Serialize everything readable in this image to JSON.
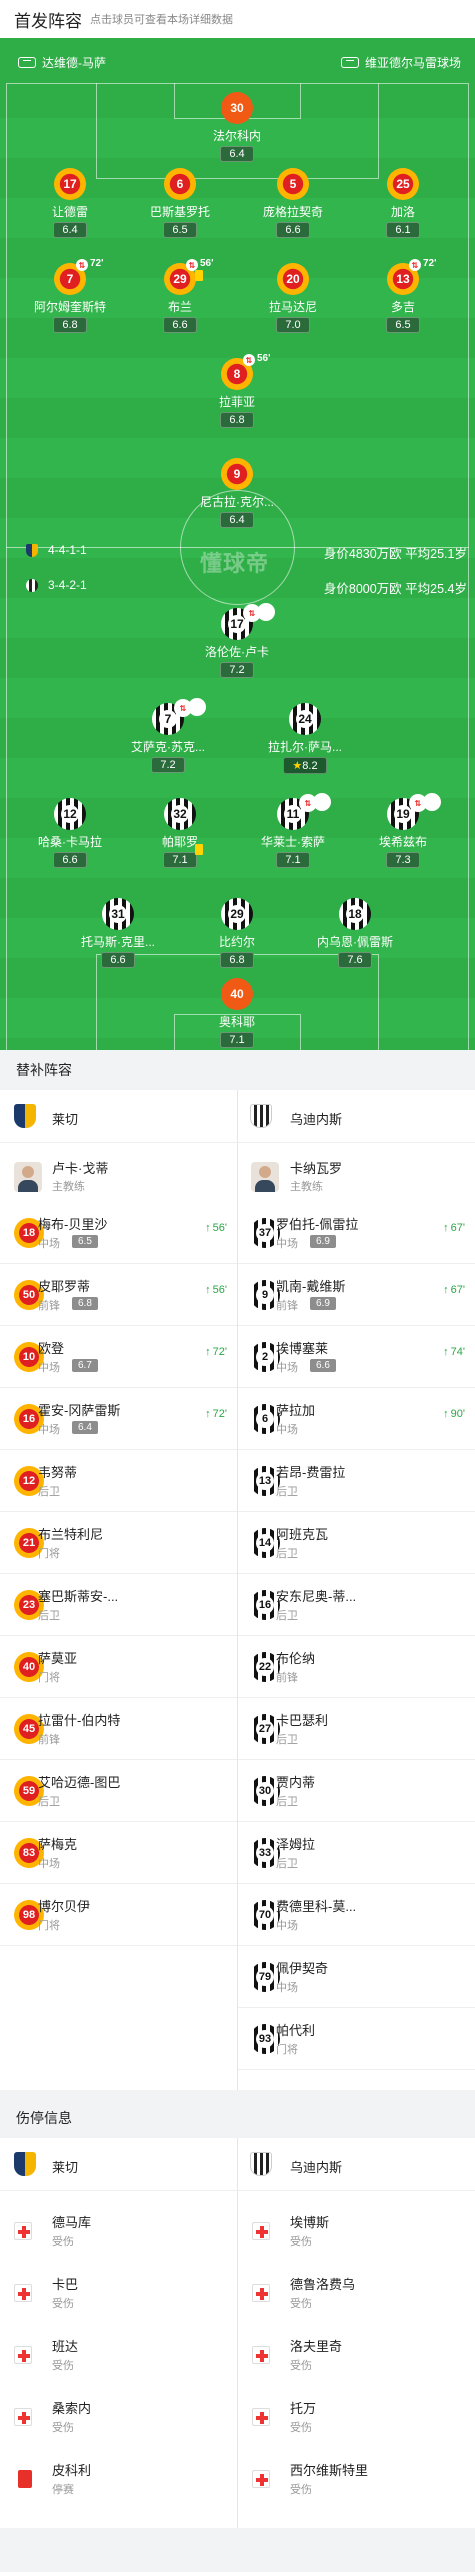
{
  "header": {
    "title": "首发阵容",
    "subtitle": "点击球员可查看本场详细数据"
  },
  "pitch": {
    "home_team_label": "达维德-马萨",
    "away_team_label": "维亚德尔马雷球场",
    "watermark": "懂球帝",
    "away_formation": "4-4-1-1",
    "away_info": "身价4830万欧 平均25.1岁",
    "home_formation": "3-4-2-1",
    "home_info": "身价8000万欧 平均25.4岁"
  },
  "lineup_top": [
    {
      "num": "30",
      "name": "法尔科内",
      "rating": "6.4",
      "kit": "gk"
    },
    {
      "num": "17",
      "name": "让德雷",
      "rating": "6.4",
      "kit": "red"
    },
    {
      "num": "6",
      "name": "巴斯基罗托",
      "rating": "6.5",
      "kit": "red"
    },
    {
      "num": "5",
      "name": "庞格拉契奇",
      "rating": "6.6",
      "kit": "red"
    },
    {
      "num": "25",
      "name": "加洛",
      "rating": "6.1",
      "kit": "red"
    },
    {
      "num": "7",
      "name": "阿尔姆奎斯特",
      "rating": "6.8",
      "kit": "red",
      "event": "72'"
    },
    {
      "num": "29",
      "name": "布兰",
      "rating": "6.6",
      "kit": "red",
      "event": "56'"
    },
    {
      "num": "20",
      "name": "拉马达尼",
      "rating": "7.0",
      "kit": "red"
    },
    {
      "num": "13",
      "name": "多吉",
      "rating": "6.5",
      "kit": "red",
      "event": "72'"
    },
    {
      "num": "8",
      "name": "拉菲亚",
      "rating": "6.8",
      "kit": "red",
      "event": "56'"
    },
    {
      "num": "9",
      "name": "尼古拉·克尔...",
      "rating": "6.4",
      "kit": "red"
    }
  ],
  "lineup_bottom": [
    {
      "num": "17",
      "name": "洛伦佐·卢卡",
      "rating": "7.2",
      "kit": "stripe",
      "event": "67'"
    },
    {
      "num": "7",
      "name": "艾萨克·苏克...",
      "rating": "7.2",
      "kit": "stripe",
      "event": "67'"
    },
    {
      "num": "24",
      "name": "拉扎尔·萨马...",
      "rating": "8.2",
      "kit": "stripe",
      "star": true
    },
    {
      "num": "12",
      "name": "哈桑·卡马拉",
      "rating": "6.6",
      "kit": "stripe"
    },
    {
      "num": "32",
      "name": "帕耶罗",
      "rating": "7.1",
      "kit": "stripe"
    },
    {
      "num": "11",
      "name": "华莱士·索萨",
      "rating": "7.1",
      "kit": "stripe",
      "event": "90'"
    },
    {
      "num": "19",
      "name": "埃希兹布",
      "rating": "7.3",
      "kit": "stripe",
      "event": "74'"
    },
    {
      "num": "31",
      "name": "托马斯·克里...",
      "rating": "6.6",
      "kit": "stripe"
    },
    {
      "num": "29",
      "name": "比约尔",
      "rating": "6.8",
      "kit": "stripe"
    },
    {
      "num": "18",
      "name": "内乌恩·佩雷斯",
      "rating": "7.6",
      "kit": "stripe"
    },
    {
      "num": "40",
      "name": "奥科耶",
      "rating": "7.1",
      "kit": "gk"
    }
  ],
  "subs_section": {
    "title": "替补阵容",
    "left_team": "莱切",
    "right_team": "乌迪内斯",
    "left_coach": {
      "name": "卢卡·戈蒂",
      "role": "主教练"
    },
    "right_coach": {
      "name": "卡纳瓦罗",
      "role": "主教练"
    },
    "left": [
      {
        "num": "18",
        "name": "梅布-贝里沙",
        "pos": "中场",
        "rating": "6.5",
        "time": "56'"
      },
      {
        "num": "50",
        "name": "皮耶罗蒂",
        "pos": "前锋",
        "rating": "6.8",
        "time": "56'"
      },
      {
        "num": "10",
        "name": "欧登",
        "pos": "中场",
        "rating": "6.7",
        "time": "72'"
      },
      {
        "num": "16",
        "name": "霍安-冈萨雷斯",
        "pos": "中场",
        "rating": "6.4",
        "time": "72'"
      },
      {
        "num": "12",
        "name": "韦努蒂",
        "pos": "后卫"
      },
      {
        "num": "21",
        "name": "布兰特利尼",
        "pos": "门将"
      },
      {
        "num": "23",
        "name": "塞巴斯蒂安-...",
        "pos": "后卫"
      },
      {
        "num": "40",
        "name": "萨莫亚",
        "pos": "门将"
      },
      {
        "num": "45",
        "name": "拉雷什-伯内特",
        "pos": "前锋"
      },
      {
        "num": "59",
        "name": "艾哈迈德-图巴",
        "pos": "后卫"
      },
      {
        "num": "83",
        "name": "萨梅克",
        "pos": "中场"
      },
      {
        "num": "98",
        "name": "博尔贝伊",
        "pos": "门将"
      }
    ],
    "right": [
      {
        "num": "37",
        "name": "罗伯托-佩雷拉",
        "pos": "中场",
        "rating": "6.9",
        "time": "67'"
      },
      {
        "num": "9",
        "name": "凯南-戴维斯",
        "pos": "前锋",
        "rating": "6.9",
        "time": "67'"
      },
      {
        "num": "2",
        "name": "埃博塞莱",
        "pos": "中场",
        "rating": "6.6",
        "time": "74'"
      },
      {
        "num": "6",
        "name": "萨拉加",
        "pos": "中场",
        "time": "90'"
      },
      {
        "num": "13",
        "name": "若昂-费雷拉",
        "pos": "后卫"
      },
      {
        "num": "14",
        "name": "阿班克瓦",
        "pos": "后卫"
      },
      {
        "num": "16",
        "name": "安东尼奥-蒂...",
        "pos": "后卫"
      },
      {
        "num": "22",
        "name": "布伦纳",
        "pos": "前锋"
      },
      {
        "num": "27",
        "name": "卡巴瑟利",
        "pos": "后卫"
      },
      {
        "num": "30",
        "name": "贾内蒂",
        "pos": "后卫"
      },
      {
        "num": "33",
        "name": "泽姆拉",
        "pos": "后卫"
      },
      {
        "num": "70",
        "name": "费德里科-莫...",
        "pos": "中场"
      },
      {
        "num": "79",
        "name": "佩伊契奇",
        "pos": "中场"
      },
      {
        "num": "93",
        "name": "帕代利",
        "pos": "门将"
      }
    ]
  },
  "injury_section": {
    "title": "伤停信息",
    "left_team": "莱切",
    "right_team": "乌迪内斯",
    "left": [
      {
        "name": "德马库",
        "status": "受伤",
        "type": "injury"
      },
      {
        "name": "卡巴",
        "status": "受伤",
        "type": "injury"
      },
      {
        "name": "班达",
        "status": "受伤",
        "type": "injury"
      },
      {
        "name": "桑索内",
        "status": "受伤",
        "type": "injury"
      },
      {
        "name": "皮科利",
        "status": "停赛",
        "type": "suspension"
      }
    ],
    "right": [
      {
        "name": "埃博斯",
        "status": "受伤",
        "type": "injury"
      },
      {
        "name": "德鲁洛费乌",
        "status": "受伤",
        "type": "injury"
      },
      {
        "name": "洛夫里奇",
        "status": "受伤",
        "type": "injury"
      },
      {
        "name": "托万",
        "status": "受伤",
        "type": "injury"
      },
      {
        "name": "西尔维斯特里",
        "status": "受伤",
        "type": "injury"
      }
    ]
  },
  "colors": {
    "pitch": "#2fae48",
    "accent_green": "#29a745",
    "lecce_red": "#e02020",
    "lecce_yellow": "#ffb400"
  }
}
